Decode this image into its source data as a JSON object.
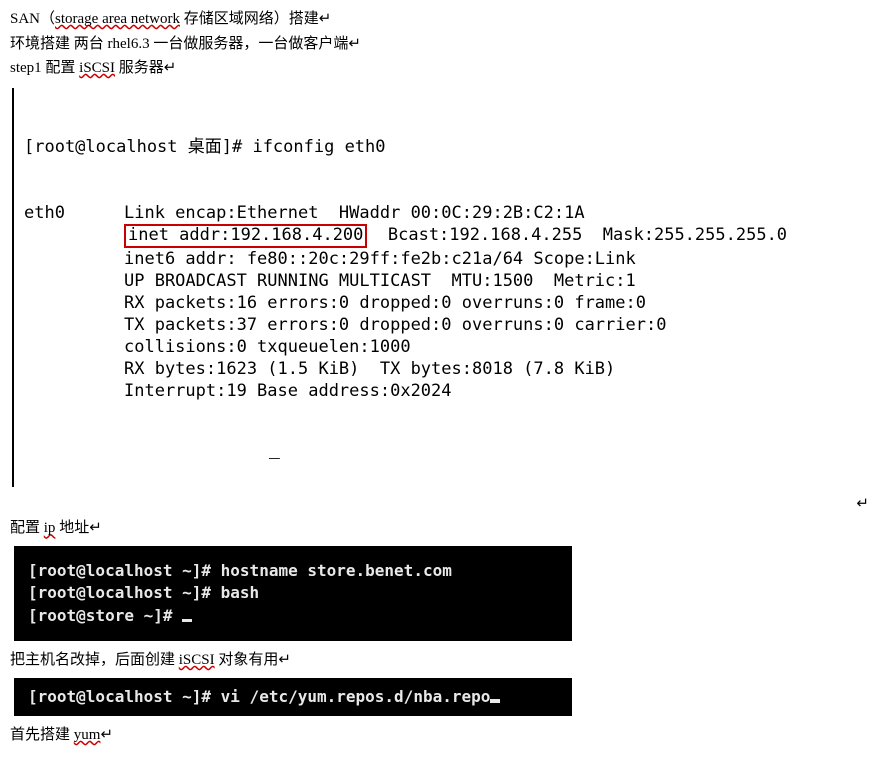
{
  "lines": {
    "l1_pre": "SAN（",
    "l1_eng": "storage area network",
    "l1_post": " 存储区域网络）搭建",
    "l2": "环境搭建 两台 rhel6.3 一台做服务器，一台做客户端",
    "l3_pre": "step1 配置 ",
    "l3_iscsi": "iSCSI",
    "l3_post": " 服务器",
    "cfgip_pre": "配置 ",
    "cfgip_ip": "ip",
    "cfgip_post": " 地址",
    "rename_pre": "把主机名改掉，后面创建 ",
    "rename_iscsi": "iSCSI",
    "rename_post": " 对象有用",
    "yum_pre": "首先搭建 ",
    "yum_yum": "yum"
  },
  "ifconfig": {
    "cmd": "[root@localhost 桌面]# ifconfig eth0",
    "iface": "eth0",
    "linkline": "Link encap:Ethernet  HWaddr 00:0C:29:2B:C2:1A",
    "inet_box": "inet addr:192.168.4.200",
    "inet_rest": "  Bcast:192.168.4.255  Mask:255.255.255.0",
    "inet6": "inet6 addr: fe80::20c:29ff:fe2b:c21a/64 Scope:Link",
    "up": "UP BROADCAST RUNNING MULTICAST  MTU:1500  Metric:1",
    "rx": "RX packets:16 errors:0 dropped:0 overruns:0 frame:0",
    "tx": "TX packets:37 errors:0 dropped:0 overruns:0 carrier:0",
    "coll": "collisions:0 txqueuelen:1000",
    "rxb": "RX bytes:1623 (1.5 KiB)  TX bytes:8018 (7.8 KiB)",
    "intr": "Interrupt:19 Base address:0x2024"
  },
  "term1": {
    "l1": "[root@localhost ~]# hostname store.benet.com",
    "l2": "[root@localhost ~]# bash",
    "l3": "[root@store ~]# "
  },
  "term2": {
    "l1": "[root@localhost ~]# vi /etc/yum.repos.d/nba.repo"
  },
  "eol": "↵"
}
